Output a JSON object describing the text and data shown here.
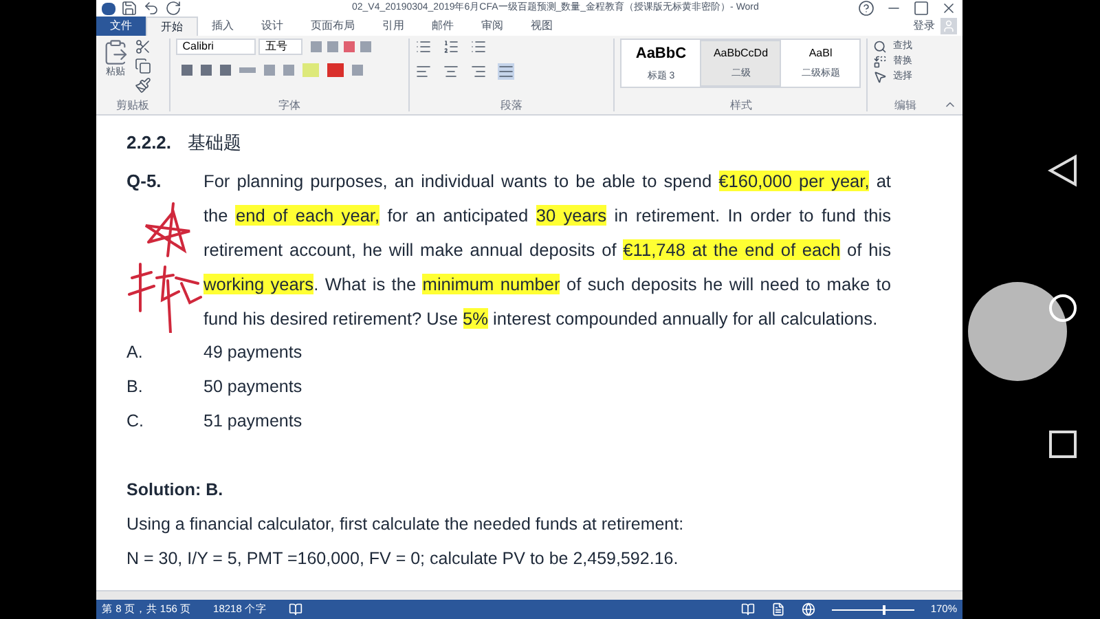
{
  "window": {
    "title": "02_V4_20190304_2019年6月CFA一级百题预测_数量_金程教育（授课版无标黄非密阶）- Word",
    "sign_in": "登录"
  },
  "ribbon_tabs": [
    {
      "label": "文件",
      "kind": "file",
      "selected": false
    },
    {
      "label": "开始",
      "kind": "tab",
      "selected": true
    },
    {
      "label": "插入",
      "kind": "tab",
      "selected": false
    },
    {
      "label": "设计",
      "kind": "tab",
      "selected": false
    },
    {
      "label": "页面布局",
      "kind": "tab",
      "selected": false
    },
    {
      "label": "引用",
      "kind": "tab",
      "selected": false
    },
    {
      "label": "邮件",
      "kind": "tab",
      "selected": false
    },
    {
      "label": "审阅",
      "kind": "tab",
      "selected": false
    },
    {
      "label": "视图",
      "kind": "tab",
      "selected": false
    }
  ],
  "ribbon": {
    "clipboard": {
      "paste": "粘贴",
      "label": "剪贴板"
    },
    "font": {
      "font_name": "Calibri",
      "font_size": "五号",
      "label": "字体"
    },
    "paragraph": {
      "label": "段落"
    },
    "styles": {
      "items": [
        {
          "preview": "AaBbC",
          "name": "标题 3",
          "selected": false
        },
        {
          "preview": "AaBbCcDd",
          "name": "二级",
          "selected": true
        },
        {
          "preview": "AaBl",
          "name": "二级标题",
          "selected": false
        }
      ],
      "label": "样式"
    },
    "editing": {
      "items": [
        "查找",
        "替换",
        "选择"
      ],
      "label": "编辑"
    }
  },
  "document": {
    "heading": {
      "number": "2.2.2.",
      "title": "基础题"
    },
    "question": {
      "number": "Q-5.",
      "segments": [
        {
          "text": "For planning purposes, an individual wants to be able to spend ",
          "highlighted": false
        },
        {
          "text": "€160,000 per year,",
          "highlighted": true
        },
        {
          "text": " at the ",
          "highlighted": false
        },
        {
          "text": "end of each year,",
          "highlighted": true
        },
        {
          "text": " for an anticipated ",
          "highlighted": false
        },
        {
          "text": "30 years",
          "highlighted": true
        },
        {
          "text": " in retirement. In order to fund this retirement account, he will make annual deposits of ",
          "highlighted": false
        },
        {
          "text": "€11,748 at the end of each",
          "highlighted": true
        },
        {
          "text": " of his ",
          "highlighted": false
        },
        {
          "text": "working years",
          "highlighted": true
        },
        {
          "text": ". What is the ",
          "highlighted": false
        },
        {
          "text": "minimum number",
          "highlighted": true
        },
        {
          "text": " of such deposits he will need to make to fund his desired retirement? Use ",
          "highlighted": false
        },
        {
          "text": "5%",
          "highlighted": true
        },
        {
          "text": " interest compounded annually for all calculations.",
          "highlighted": false
        }
      ]
    },
    "options": [
      {
        "letter": "A.",
        "text": "49 payments"
      },
      {
        "letter": "B.",
        "text": "50 payments"
      },
      {
        "letter": "C.",
        "text": "51 payments"
      }
    ],
    "solution": "Solution: B.",
    "lines": [
      "Using a financial calculator, first calculate the needed funds at retirement:",
      "N = 30, I/Y = 5, PMT =160,000, FV = 0; calculate PV to be 2,459,592.16."
    ]
  },
  "status_bar": {
    "page": "第 8 页，共 156 页",
    "words": "18218 个字",
    "zoom": "170%",
    "zoom_slider": {
      "level": 0.62
    }
  }
}
